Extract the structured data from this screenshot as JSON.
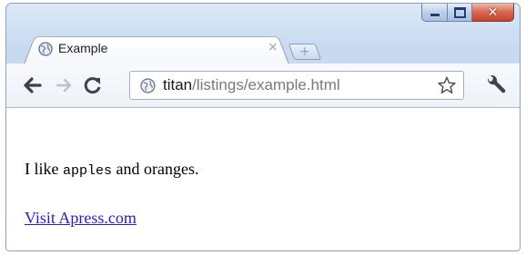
{
  "window": {
    "controls": [
      "minimize-icon",
      "maximize-icon",
      "close-icon"
    ]
  },
  "tab": {
    "title": "Example",
    "close_glyph": "×",
    "favicon": "globe-icon"
  },
  "new_tab": {
    "glyph": "+"
  },
  "toolbar": {
    "back": "back-arrow-icon",
    "forward": "forward-arrow-icon",
    "reload": "reload-icon",
    "bookmark": "star-icon",
    "menu": "wrench-icon"
  },
  "address_bar": {
    "host": "titan",
    "path": "/listings/example.html"
  },
  "page": {
    "text_before": "I like ",
    "code_text": "apples",
    "text_after": " and oranges.",
    "link_text": "Visit Apress.com"
  },
  "colors": {
    "frame": "#bcd1ec",
    "link": "#2a1ad6",
    "close_button": "#d9664d"
  }
}
